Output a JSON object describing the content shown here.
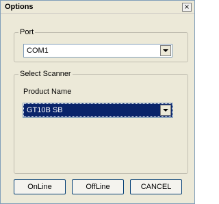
{
  "window": {
    "title": "Options",
    "close_glyph": "×"
  },
  "port": {
    "legend": "Port",
    "selected": "COM1"
  },
  "scanner": {
    "legend": "Select Scanner",
    "product_label": "Product Name",
    "selected": "GT10B SB"
  },
  "buttons": {
    "online": "OnLine",
    "offline": "OffLine",
    "cancel": "CANCEL"
  },
  "colors": {
    "dialog_bg": "#ece9d8",
    "selection_bg": "#0a246a",
    "selection_fg": "#ffffff"
  }
}
